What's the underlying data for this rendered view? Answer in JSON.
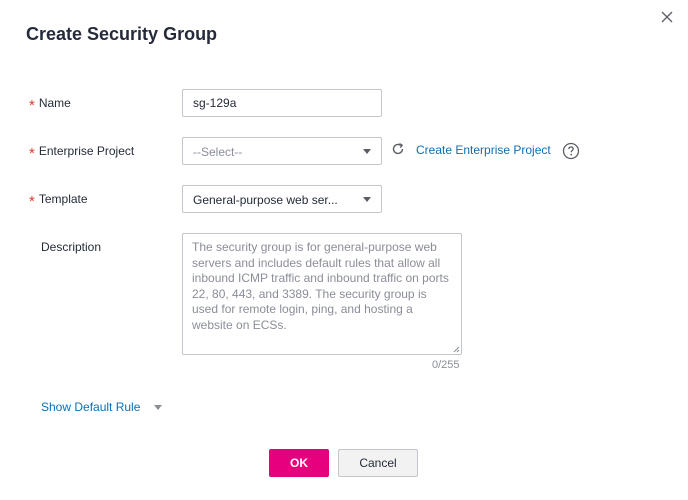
{
  "dialog": {
    "title": "Create Security Group"
  },
  "form": {
    "name": {
      "label": "Name",
      "required": true,
      "value": "sg-129a"
    },
    "enterprise_project": {
      "label": "Enterprise Project",
      "required": true,
      "placeholder": "--Select--",
      "create_link": "Create Enterprise Project"
    },
    "template": {
      "label": "Template",
      "required": true,
      "selected": "General-purpose web ser..."
    },
    "description": {
      "label": "Description",
      "value": "The security group is for general-purpose web servers and includes default rules that allow all inbound ICMP traffic and inbound traffic on ports 22, 80, 443, and 3389. The security group is used for remote login, ping, and hosting a website on ECSs.",
      "counter": "0/255"
    }
  },
  "show_default_rule": "Show Default Rule",
  "buttons": {
    "ok": "OK",
    "cancel": "Cancel"
  },
  "colors": {
    "primary": "#e6007e",
    "link": "#0b6fb5",
    "required": "#e53935"
  },
  "icons": {
    "close": "close-icon",
    "refresh": "refresh-icon",
    "help": "help-icon",
    "caret": "chevron-down-icon"
  }
}
